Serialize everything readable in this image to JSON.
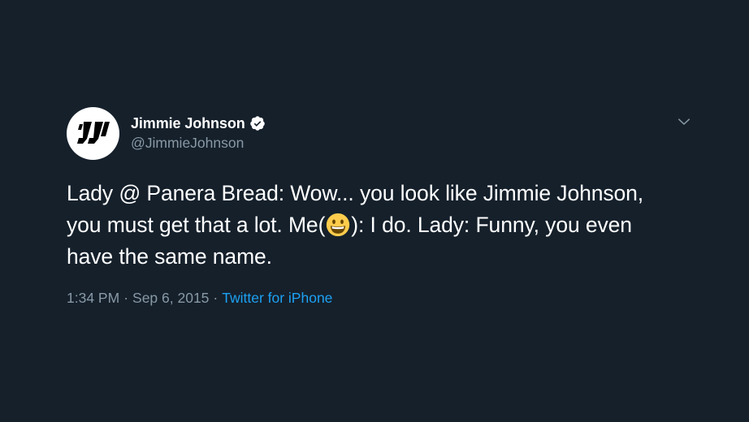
{
  "tweet": {
    "author": {
      "display_name": "Jimmie Johnson",
      "handle": "@JimmieJohnson",
      "verified": true,
      "avatar_icon": "jj-logo-icon"
    },
    "text_parts": {
      "before_emoji": "Lady @ Panera Bread: Wow... you look like Jimmie Johnson, you must get that a lot. Me(",
      "emoji": "grinning-face",
      "after_emoji": "): I do. Lady: Funny, you even have the same name."
    },
    "meta": {
      "time": "1:34 PM",
      "separator": "·",
      "date": "Sep 6, 2015",
      "source": "Twitter for iPhone"
    },
    "menu_icon": "chevron-down-icon"
  },
  "colors": {
    "background": "#15202b",
    "text_primary": "#ffffff",
    "text_secondary": "#8899a6",
    "link": "#1da1f2",
    "verified_badge": "#ffffff"
  }
}
